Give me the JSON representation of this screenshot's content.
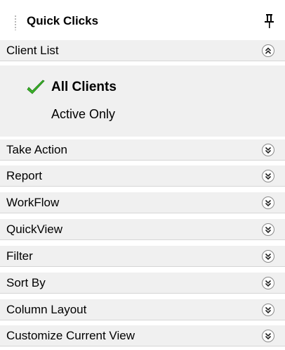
{
  "panel": {
    "title": "Quick Clicks",
    "pin_icon": "pin-icon"
  },
  "client_list": {
    "label": "Client List",
    "expanded": true,
    "options": [
      {
        "label": "All Clients",
        "selected": true
      },
      {
        "label": "Active Only",
        "selected": false
      }
    ]
  },
  "sections": [
    {
      "label": "Take Action"
    },
    {
      "label": "Report"
    },
    {
      "label": "WorkFlow"
    },
    {
      "label": "QuickView"
    },
    {
      "label": "Filter"
    },
    {
      "label": "Sort By"
    },
    {
      "label": "Column Layout"
    },
    {
      "label": "Customize Current View"
    }
  ],
  "colors": {
    "header_bg": "#f0f0f0",
    "check_green": "#3bb42a"
  },
  "icons": {
    "collapse": "chevron-double-up-icon",
    "expand": "chevron-double-down-icon"
  }
}
